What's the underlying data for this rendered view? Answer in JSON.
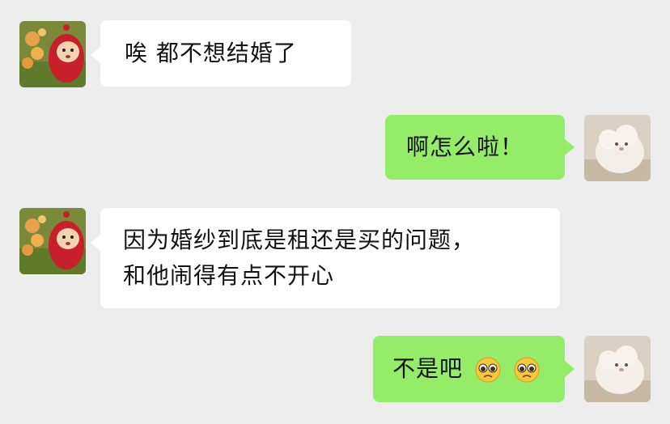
{
  "messages": [
    {
      "side": "left",
      "text": "唉 都不想结婚了",
      "avatar": "teletubby-po-avatar"
    },
    {
      "side": "right",
      "text": "啊怎么啦！",
      "avatar": "white-lamb-avatar"
    },
    {
      "side": "left",
      "line1": "因为婚纱到底是租还是买的问题，",
      "line2": "和他闹得有点不开心",
      "avatar": "teletubby-po-avatar"
    },
    {
      "side": "right",
      "text": "不是吧",
      "emojis": [
        "pleading-face-emoji",
        "pleading-face-emoji"
      ],
      "avatar": "white-lamb-avatar"
    }
  ],
  "colors": {
    "background": "#ededed",
    "left_bubble": "#ffffff",
    "right_bubble": "#95ec69"
  }
}
